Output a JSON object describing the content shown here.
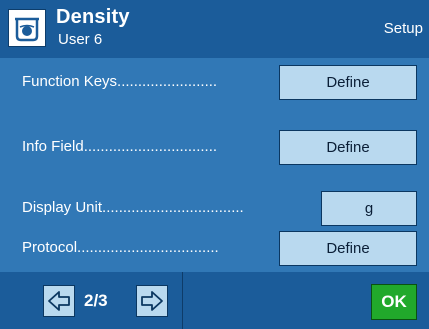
{
  "header": {
    "icon": "density-beaker-icon",
    "title": "Density",
    "subtitle": "User 6",
    "mode": "Setup"
  },
  "rows": [
    {
      "label": "Function Keys........................",
      "button": "Define"
    },
    {
      "label": "Info Field................................",
      "button": "Define"
    },
    {
      "label": "Display Unit..................................",
      "button": "g"
    },
    {
      "label": "Protocol..................................",
      "button": "Define"
    }
  ],
  "footer": {
    "page": "2/3",
    "prev_icon": "arrow-left-icon",
    "next_icon": "arrow-right-icon",
    "ok": "OK"
  },
  "colors": {
    "header_bg": "#1b5c9a",
    "content_bg": "#3178b6",
    "button_bg": "#b9d9ef",
    "ok_bg": "#21a92b"
  }
}
